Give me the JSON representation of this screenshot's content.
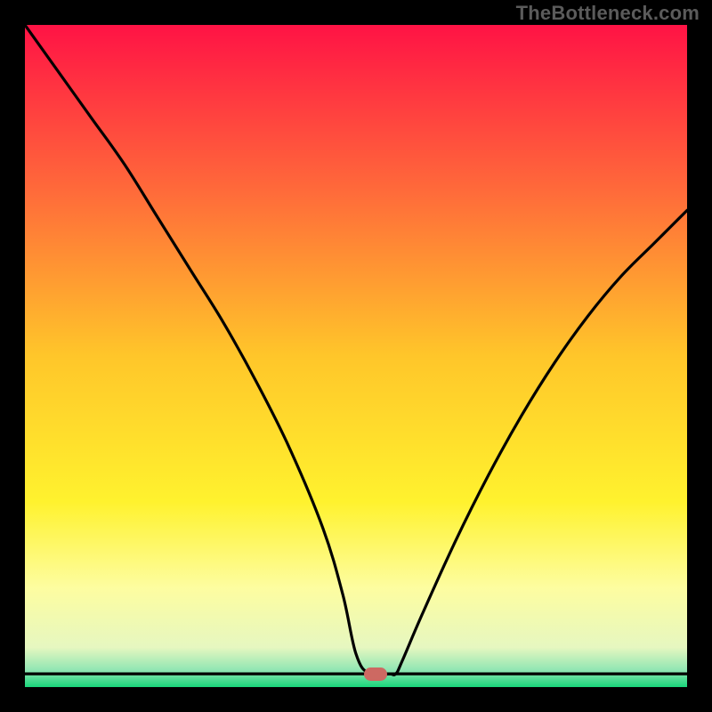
{
  "watermark": "TheBottleneck.com",
  "chart_data": {
    "type": "line",
    "title": "",
    "xlabel": "",
    "ylabel": "",
    "xlim": [
      0,
      100
    ],
    "ylim": [
      0,
      100
    ],
    "grid": false,
    "legend": false,
    "background_gradient": {
      "stops": [
        {
          "pos": 0.0,
          "color": "#ff1345"
        },
        {
          "pos": 0.25,
          "color": "#ff6a3a"
        },
        {
          "pos": 0.5,
          "color": "#ffc62a"
        },
        {
          "pos": 0.72,
          "color": "#fff22e"
        },
        {
          "pos": 0.85,
          "color": "#fdfda0"
        },
        {
          "pos": 0.94,
          "color": "#e6f7c0"
        },
        {
          "pos": 0.975,
          "color": "#8fe6b3"
        },
        {
          "pos": 1.0,
          "color": "#18d67a"
        }
      ]
    },
    "marker": {
      "x": 53,
      "y": 2,
      "color": "#cd6962"
    },
    "series": [
      {
        "name": "curve",
        "x": [
          0,
          5,
          10,
          15,
          20,
          25,
          30,
          35,
          40,
          45,
          48,
          50,
          52,
          55,
          56,
          57,
          60,
          65,
          70,
          75,
          80,
          85,
          90,
          95,
          100
        ],
        "values": [
          100,
          93,
          86,
          79,
          71,
          63,
          55,
          46,
          36,
          24,
          14,
          5,
          2,
          2,
          2,
          4,
          11,
          22,
          32,
          41,
          49,
          56,
          62,
          67,
          72
        ]
      }
    ]
  }
}
